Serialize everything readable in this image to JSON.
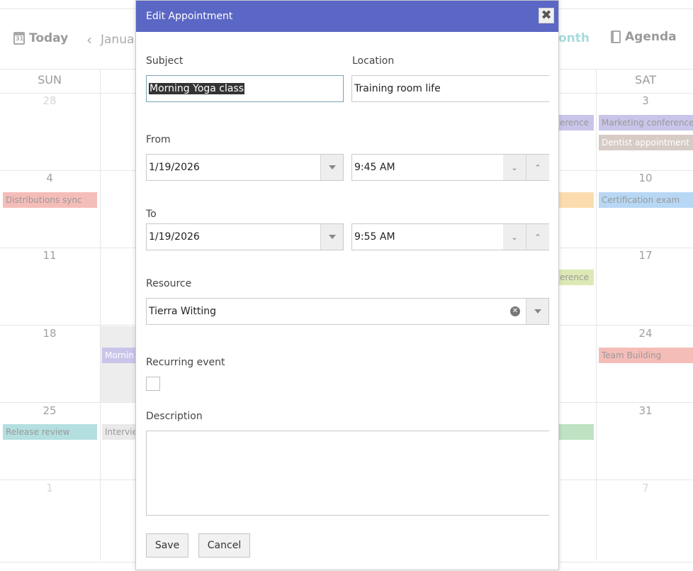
{
  "calendar": {
    "toolbar": {
      "today_label": "Today",
      "prev_label": "Januar",
      "month_label": "onth",
      "agenda_label": "Agenda"
    },
    "day_names": {
      "sun": "SUN",
      "sat": "SAT"
    },
    "weeks": [
      {
        "sun": "28",
        "sat": "3"
      },
      {
        "sun": "4",
        "sat": "10"
      },
      {
        "sun": "11",
        "sat": "17"
      },
      {
        "sun": "18",
        "sat": "24"
      },
      {
        "sun": "25",
        "sat": "31"
      },
      {
        "sun": "1",
        "sat": "7"
      }
    ],
    "events": {
      "marketing": "Marketing conference",
      "dentist": "Dentist appointment",
      "conference_partial_1": "erence",
      "distributions": "Distributions sync",
      "certification": "Certification exam",
      "conference_partial_2": "erence",
      "morning_partial": "Mornin",
      "team_building": "Team Building",
      "release_review": "Release review",
      "interview_partial": "Intervie"
    },
    "colors": {
      "purple": "#c9c5ea",
      "brown": "#d7cbc6",
      "red": "#f5bdb8",
      "orange": "#fcdcae",
      "blue": "#b7d7f4",
      "lime": "#dde9b5",
      "teal": "#b4dfe0",
      "green": "#bfe2c3",
      "gray": "#e9e9e9"
    }
  },
  "dialog": {
    "title": "Edit Appointment",
    "close_icon": "close-icon",
    "subject": {
      "label": "Subject",
      "value": "Morning Yoga class"
    },
    "location": {
      "label": "Location",
      "value": "Training room life"
    },
    "from": {
      "label": "From",
      "date": "1/19/2026",
      "time": "9:45 AM"
    },
    "to": {
      "label": "To",
      "date": "1/19/2026",
      "time": "9:55 AM"
    },
    "resource": {
      "label": "Resource",
      "value": "Tierra Witting"
    },
    "recurring": {
      "label": "Recurring event",
      "checked": false
    },
    "description": {
      "label": "Description",
      "value": ""
    },
    "buttons": {
      "save": "Save",
      "cancel": "Cancel"
    },
    "header_color": "#5b67c4"
  }
}
